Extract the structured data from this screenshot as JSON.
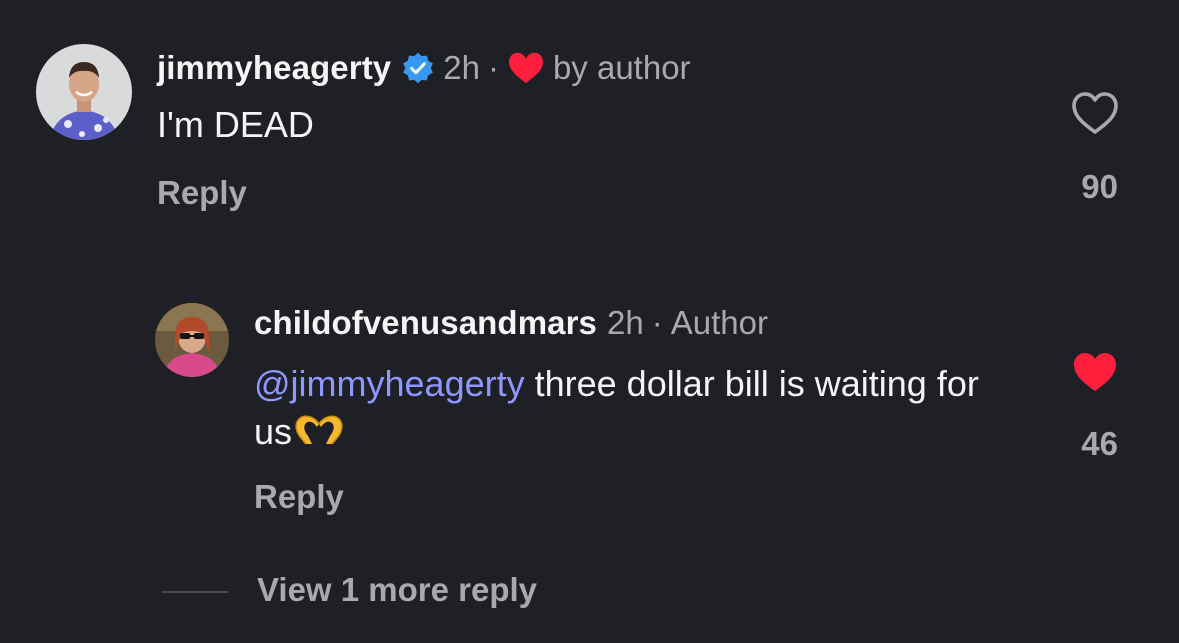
{
  "comments": [
    {
      "username": "jimmyheagerty",
      "verified": true,
      "time": "2h",
      "separator": "·",
      "liked_by_author_label": "by author",
      "text": "I'm DEAD",
      "reply_label": "Reply",
      "like_count": "90",
      "liked": false,
      "avatar_icon": "avatar-man-floral-shirt"
    },
    {
      "username": "childofvenusandmars",
      "time": "2h",
      "separator": "·",
      "author_badge": "Author",
      "mention": "@jimmyheagerty",
      "text": " three dollar bill is waiting for us",
      "emoji": "heart-hands-emoji",
      "reply_label": "Reply",
      "like_count": "46",
      "liked": true,
      "avatar_icon": "avatar-woman-sunglasses"
    }
  ],
  "view_more_label": "View 1 more reply",
  "colors": {
    "background": "#1f2025",
    "primary_text": "#f5f5f5",
    "secondary_text": "#a8a8ad",
    "mention": "#8d97ff",
    "like_red": "#ff1f3d",
    "verified_blue": "#3897f0"
  }
}
